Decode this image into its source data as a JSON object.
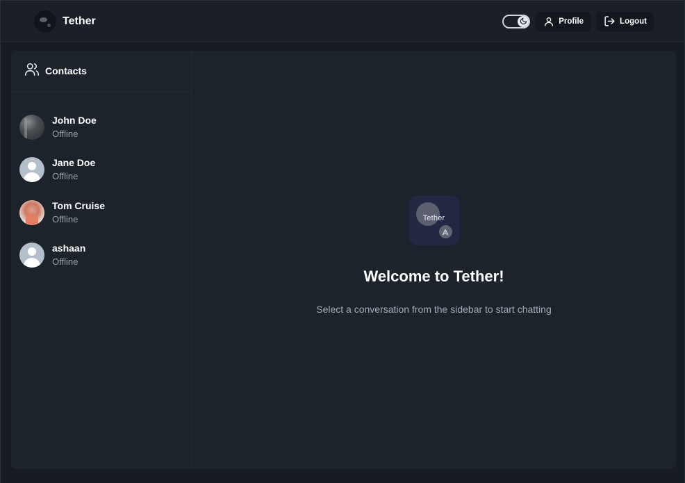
{
  "app": {
    "name": "Tether"
  },
  "header": {
    "profile_label": "Profile",
    "logout_label": "Logout"
  },
  "sidebar": {
    "title": "Contacts",
    "contacts": [
      {
        "name": "John Doe",
        "status": "Offline",
        "avatar": "photo"
      },
      {
        "name": "Jane Doe",
        "status": "Offline",
        "avatar": "default-user-icon"
      },
      {
        "name": "Tom Cruise",
        "status": "Offline",
        "avatar": "photo"
      },
      {
        "name": "ashaan",
        "status": "Offline",
        "avatar": "default-user-icon"
      }
    ]
  },
  "main": {
    "logo_text": "Tether",
    "welcome_title": "Welcome to Tether!",
    "welcome_subtitle": "Select a conversation from the sidebar to start chatting"
  },
  "colors": {
    "background": "#171c23",
    "panel": "#1d232b",
    "header": "#1b2028",
    "muted_text": "#9aa3ad",
    "logo_tile": "#232842"
  }
}
